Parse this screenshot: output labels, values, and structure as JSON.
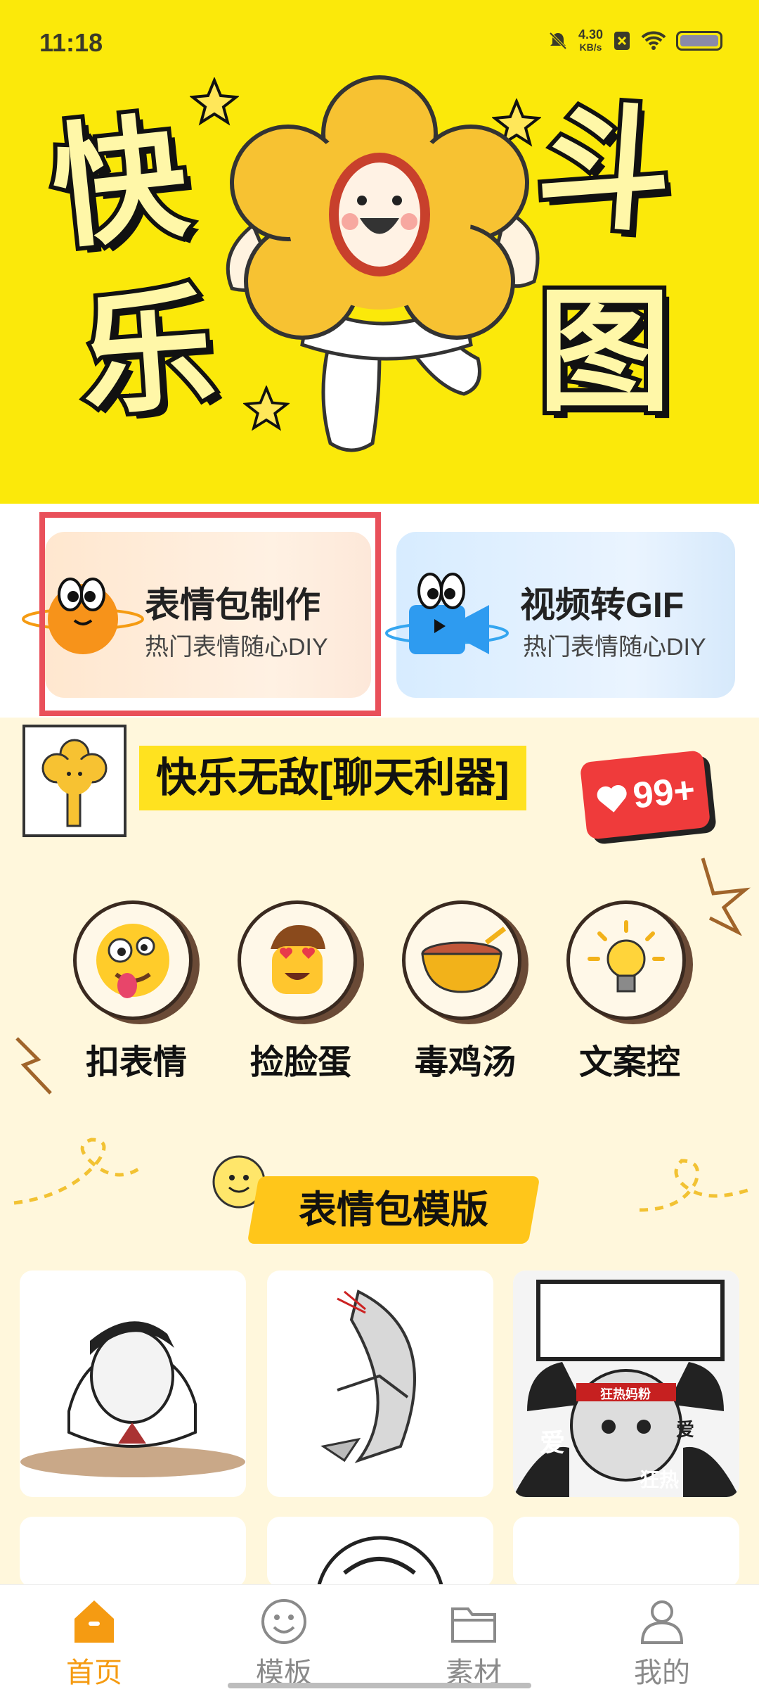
{
  "status_bar": {
    "time": "11:18",
    "net_speed_value": "4.30",
    "net_speed_unit": "KB/s"
  },
  "hero": {
    "chars": [
      "快",
      "乐",
      "斗",
      "图"
    ]
  },
  "features": [
    {
      "title": "表情包制作",
      "subtitle": "热门表情随心DIY"
    },
    {
      "title": "视频转GIF",
      "subtitle": "热门表情随心DIY"
    }
  ],
  "categories_section": {
    "title": "快乐无敌[聊天利器]",
    "likes": "99+",
    "items": [
      {
        "label": "扣表情",
        "icon": "crazy-face-emoji-icon"
      },
      {
        "label": "捡脸蛋",
        "icon": "heart-eyes-face-emoji-icon"
      },
      {
        "label": "毒鸡汤",
        "icon": "soup-bowl-icon"
      },
      {
        "label": "文案控",
        "icon": "lightbulb-icon"
      }
    ]
  },
  "templates": {
    "title": "表情包模版",
    "meme_texts": {
      "headband": "狂热妈粉",
      "love_left": "爱",
      "love_right": "爱",
      "crazy": "狂热"
    }
  },
  "bottom_nav": [
    {
      "label": "首页",
      "icon": "home-icon",
      "active": true
    },
    {
      "label": "模板",
      "icon": "smiley-icon",
      "active": false
    },
    {
      "label": "素材",
      "icon": "folder-icon",
      "active": false
    },
    {
      "label": "我的",
      "icon": "person-icon",
      "active": false
    }
  ],
  "colors": {
    "hero_yellow": "#fbe90a",
    "accent_orange": "#f59b12",
    "highlight_red": "#e9505a",
    "panel_cream": "#fff7dc"
  }
}
